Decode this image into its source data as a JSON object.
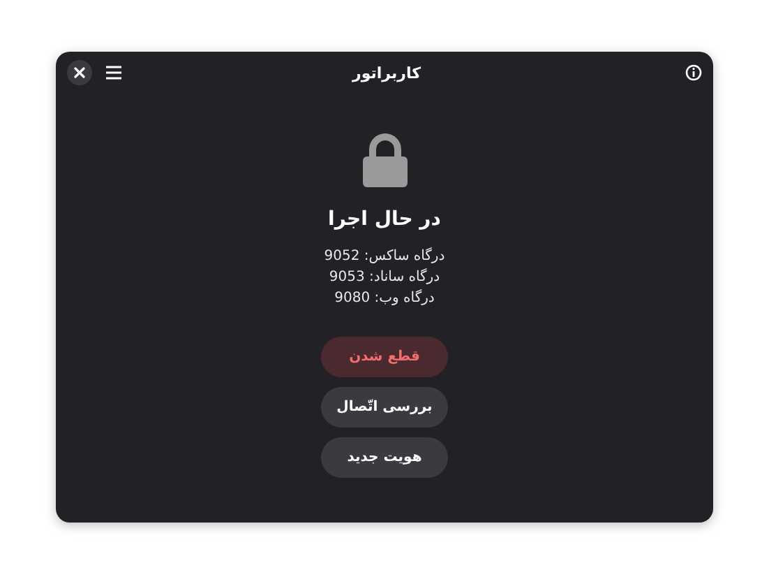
{
  "window": {
    "title": "کاربراتور"
  },
  "status": {
    "title": "در حال اجرا",
    "locked": true
  },
  "ports": [
    "درگاه ساکس: 9052",
    "درگاه ساناد: 9053",
    "درگاه وب: 9080"
  ],
  "buttons": [
    {
      "label": "قطع شدن",
      "kind": "destructive"
    },
    {
      "label": "بررسی اتّصال",
      "kind": "normal"
    },
    {
      "label": "هویت جدید",
      "kind": "normal"
    }
  ]
}
